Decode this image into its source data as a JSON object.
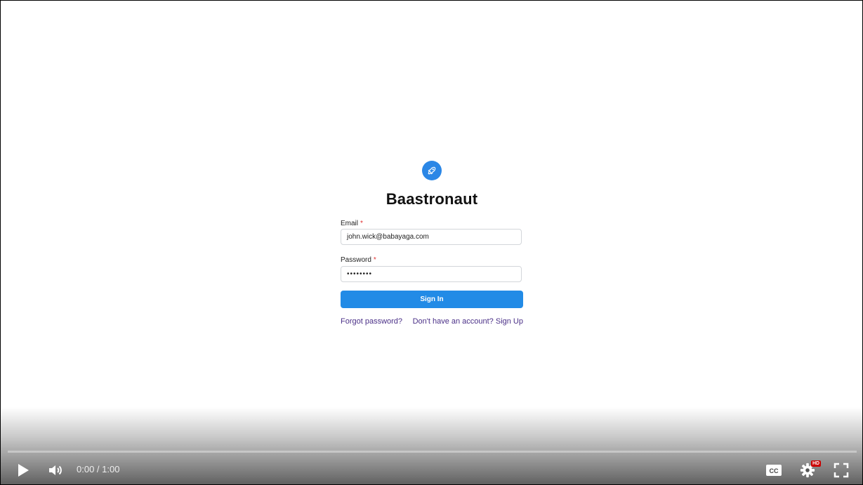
{
  "app": {
    "title": "Baastronaut",
    "logo_icon": "rocket-icon",
    "accent_color": "#228be6"
  },
  "form": {
    "email": {
      "label": "Email",
      "required_mark": "*",
      "value": "john.wick@babayaga.com"
    },
    "password": {
      "label": "Password",
      "required_mark": "*",
      "value": "••••••••"
    },
    "submit_label": "Sign In",
    "forgot_link": "Forgot password?",
    "signup_link": "Don't have an account? Sign Up"
  },
  "player": {
    "time": "0:00 / 1:00",
    "progress_fraction": 0,
    "quality_badge": "HD",
    "icons": {
      "play": "play-icon",
      "volume": "volume-icon",
      "captions": "captions-icon",
      "settings": "settings-icon",
      "fullscreen": "fullscreen-icon"
    }
  }
}
